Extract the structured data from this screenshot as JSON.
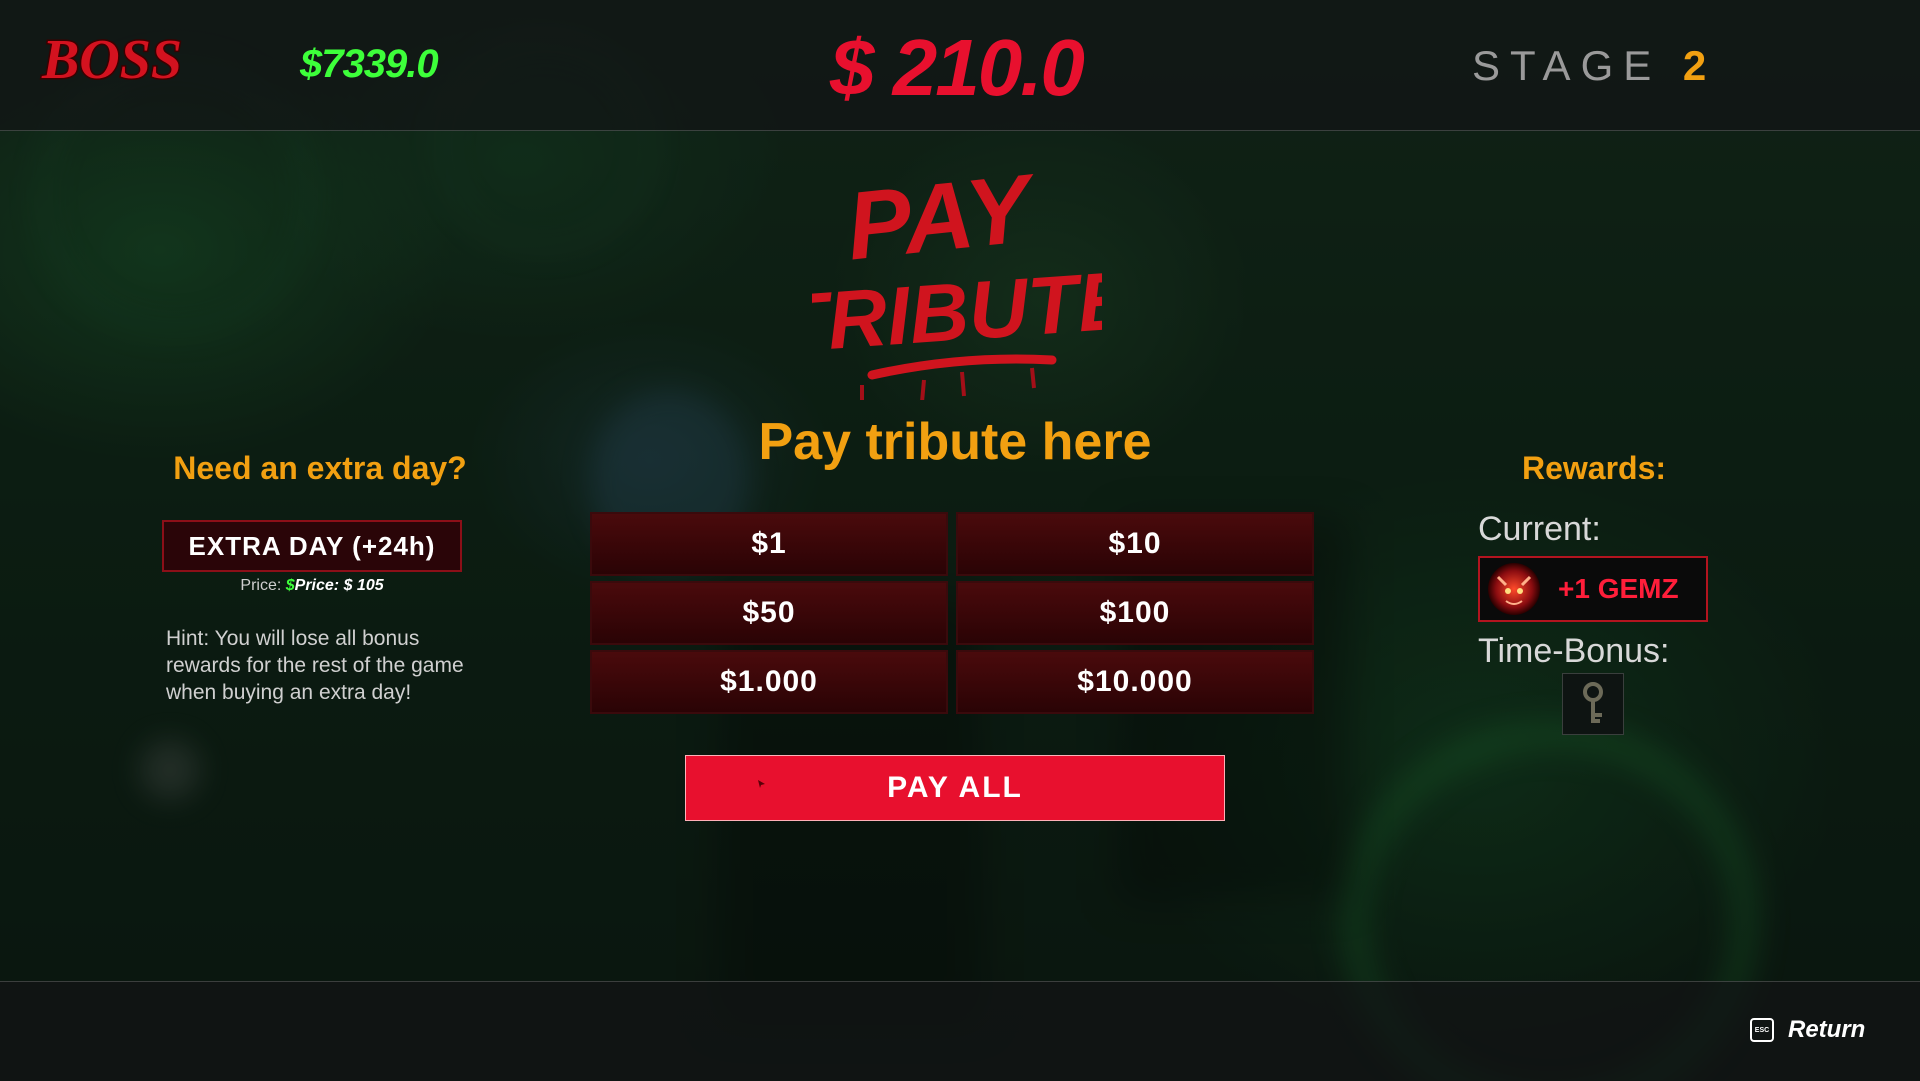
{
  "hud": {
    "logo_text": "BOSS",
    "player_money": "$7339.0",
    "tribute_amount": "$ 210.0",
    "stage_label": "STAGE",
    "stage_number": "2"
  },
  "title": {
    "art_line1": "PAY",
    "art_line2": "TRIBUTE",
    "heading": "Pay tribute here"
  },
  "extra_day": {
    "heading": "Need an extra day?",
    "button_label": "EXTRA DAY (+24h)",
    "price_prefix": "Price:",
    "price_dollar": "$",
    "price_value": "Price: $ 105",
    "hint": "Hint: You will lose all bonus rewards for the rest of the game when buying an extra day!"
  },
  "amounts": [
    "$1",
    "$10",
    "$50",
    "$100",
    "$1.000",
    "$10.000"
  ],
  "pay_all_label": "PAY ALL",
  "rewards": {
    "heading": "Rewards:",
    "current_label": "Current:",
    "current_reward": "+1 GEMZ",
    "time_bonus_label": "Time-Bonus:",
    "time_bonus_icon": "key-icon",
    "current_icon": "demon-gem-icon"
  },
  "footer": {
    "esc_key": "ESC",
    "return_label": "Return"
  },
  "colors": {
    "accent_red": "#e8102e",
    "money_green": "#3dff3a",
    "gold": "#f2a011"
  }
}
